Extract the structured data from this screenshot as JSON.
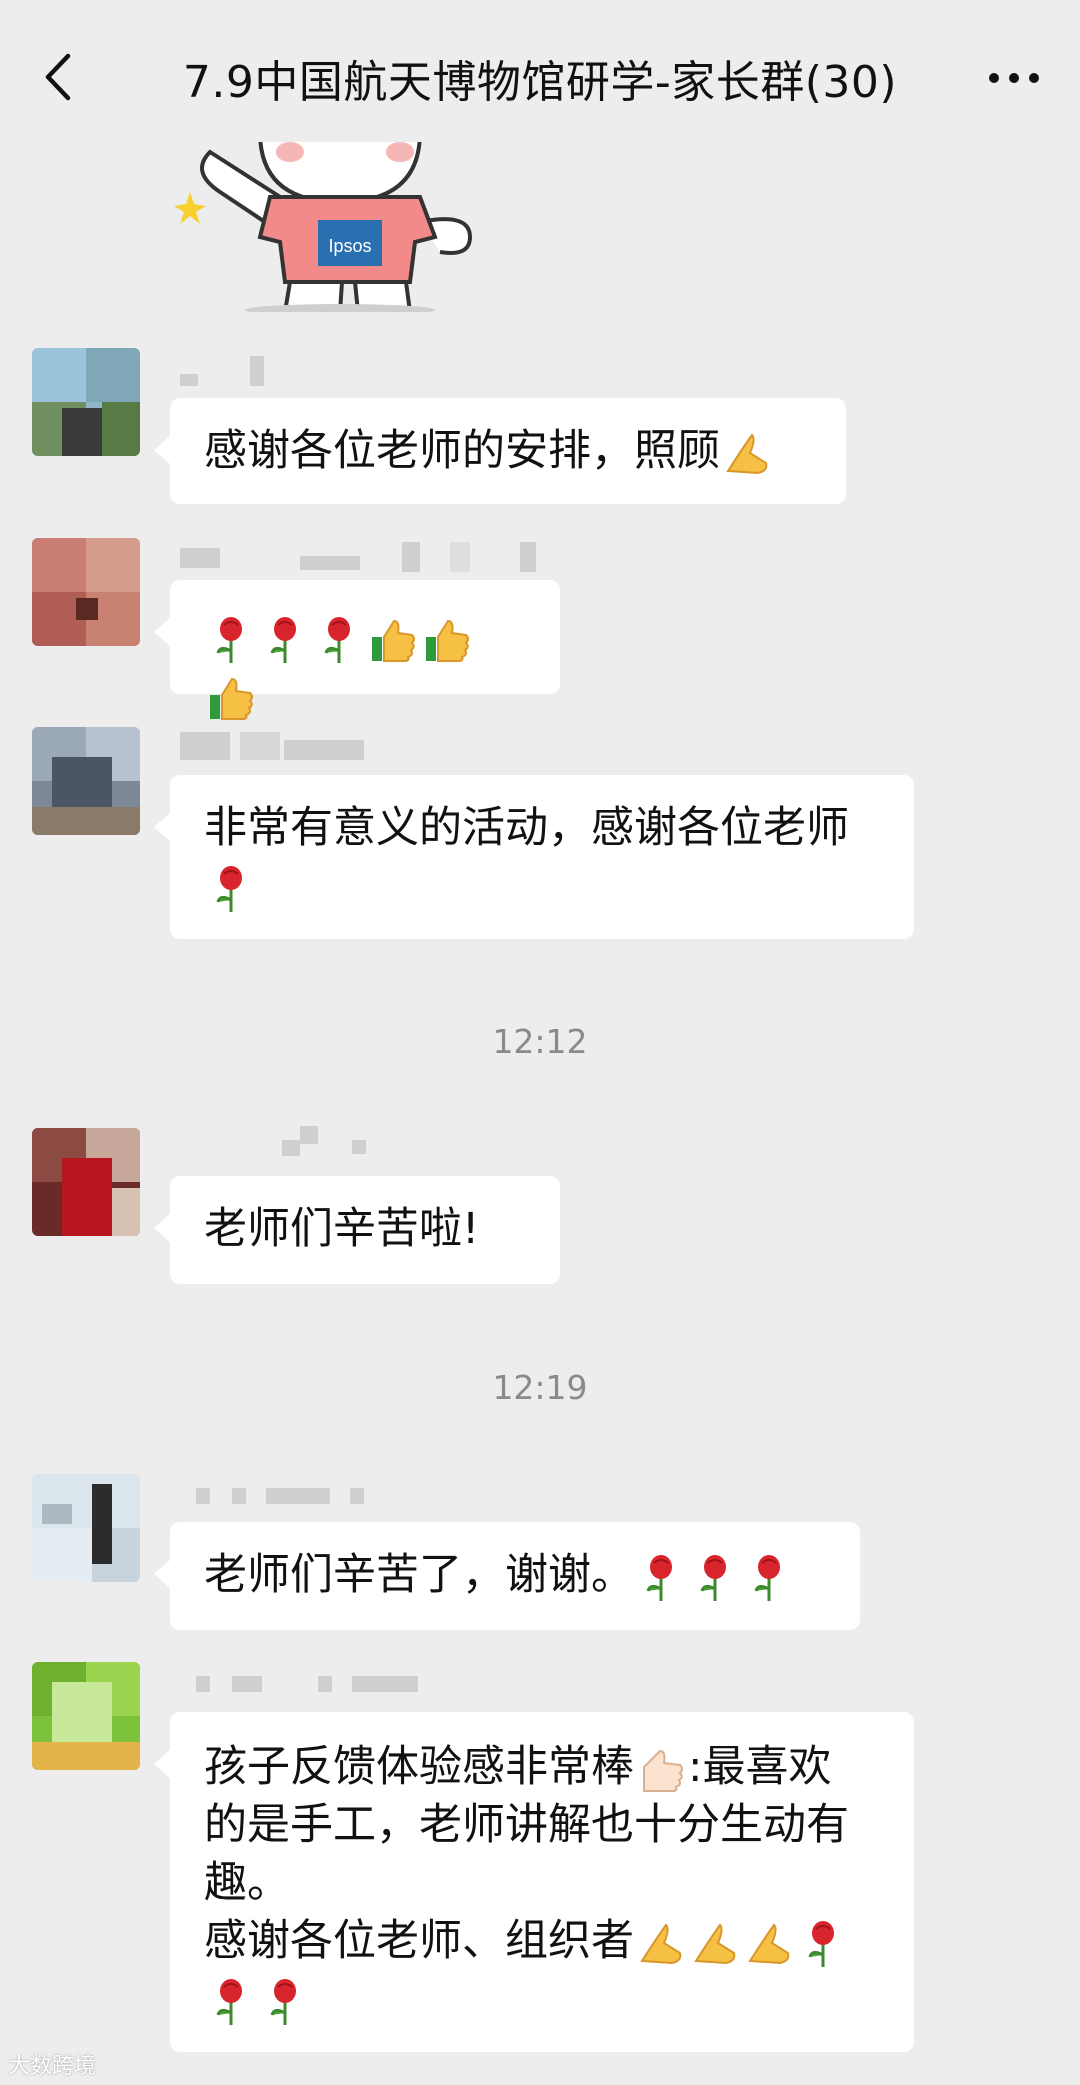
{
  "header": {
    "title": "7.9中国航天博物馆研学-家长群(30)",
    "back_icon": "back-arrow-icon",
    "more_icon": "more-dots-icon"
  },
  "sticker": {
    "shirt_text": "Ipsos"
  },
  "messages": [
    {
      "text": "感谢各位老师的安排，照顾",
      "emoji": [
        "folded-hands"
      ]
    },
    {
      "text": "",
      "emoji": [
        "rose",
        "rose",
        "rose",
        "thumbs-up",
        "thumbs-up",
        "thumbs-up"
      ]
    },
    {
      "line1": "非常有意义的活动，感谢各位老师",
      "emoji": [
        "rose"
      ]
    },
    {
      "text": "老师们辛苦啦!"
    },
    {
      "text": "老师们辛苦了，谢谢。",
      "emoji": [
        "rose",
        "rose",
        "rose"
      ]
    },
    {
      "line1a": "孩子反馈体验感非常棒",
      "line1b": ":最喜欢",
      "line2": "的是手工，老师讲解也十分生动有",
      "line3": "趣。",
      "line4": "感谢各位老师、组织者",
      "emoji": [
        "thumbs-up",
        "folded-hands",
        "folded-hands",
        "folded-hands",
        "rose",
        "rose",
        "rose"
      ]
    }
  ],
  "times": [
    "12:12",
    "12:19"
  ],
  "watermark": "大数跨境",
  "colors": {
    "background": "#ededed",
    "bubble": "#ffffff",
    "time": "#8a8a8a"
  }
}
